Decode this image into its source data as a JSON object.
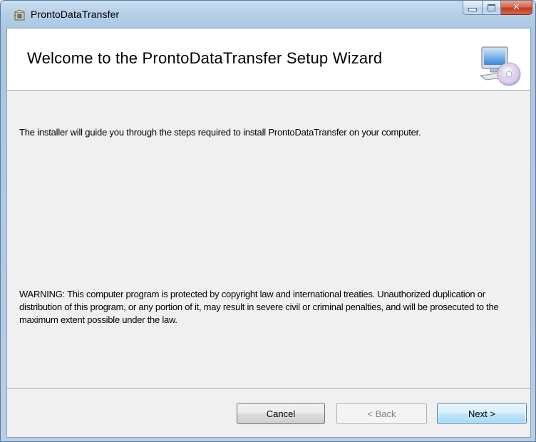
{
  "window": {
    "title": "ProntoDataTransfer"
  },
  "icons": {
    "app": "installer-box-icon",
    "minimize": "minimize-icon",
    "maximize": "maximize-icon",
    "close": "close-icon",
    "banner": "computer-cd-icon"
  },
  "banner": {
    "title": "Welcome to the ProntoDataTransfer Setup Wizard"
  },
  "content": {
    "intro": "The installer will guide you through the steps required to install ProntoDataTransfer on your computer.",
    "warning": "WARNING: This computer program is protected by copyright law and international treaties. Unauthorized duplication or distribution of this program, or any portion of it, may result in severe civil or criminal penalties, and will be prosecuted to the maximum extent possible under the law."
  },
  "buttons": {
    "cancel": "Cancel",
    "back": "< Back",
    "next": "Next >"
  },
  "colors": {
    "titlebar": "#b6d0e8",
    "client": "#f0f0f0",
    "close_button": "#c0391f",
    "default_button_border": "#3c7fb1"
  }
}
